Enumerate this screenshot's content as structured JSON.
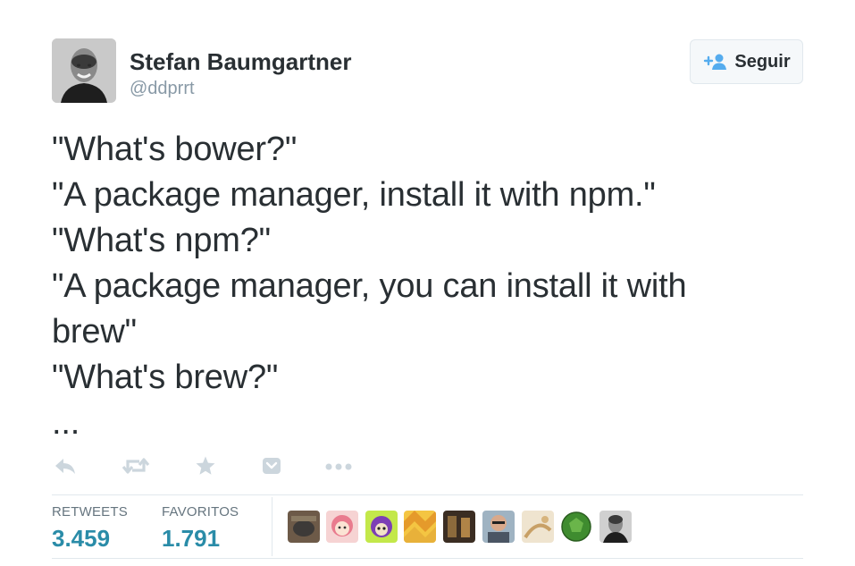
{
  "author": {
    "name": "Stefan Baumgartner",
    "handle": "@ddprrt"
  },
  "follow_button": {
    "label": "Seguir",
    "icon": "add-person-icon"
  },
  "tweet": {
    "lines": [
      "\"What's bower?\"",
      "\"A package manager, install it with npm.\"",
      "\"What's npm?\"",
      "\"A package manager, you can install it with",
      "brew\"",
      "\"What's brew?\"",
      "..."
    ]
  },
  "actions": [
    {
      "name": "reply-icon"
    },
    {
      "name": "retweet-icon"
    },
    {
      "name": "favorite-icon"
    },
    {
      "name": "pocket-icon"
    },
    {
      "name": "more-icon"
    }
  ],
  "stats": {
    "retweets": {
      "label": "RETWEETS",
      "value": "3.459"
    },
    "favorites": {
      "label": "FAVORITOS",
      "value": "1.791"
    }
  },
  "colors": {
    "text": "#292f33",
    "muted": "#8899a6",
    "stat_value": "#2a8ca8",
    "follow_icon": "#55acee",
    "action_icon": "#ccd6dd",
    "divider": "#e1e8ed"
  }
}
